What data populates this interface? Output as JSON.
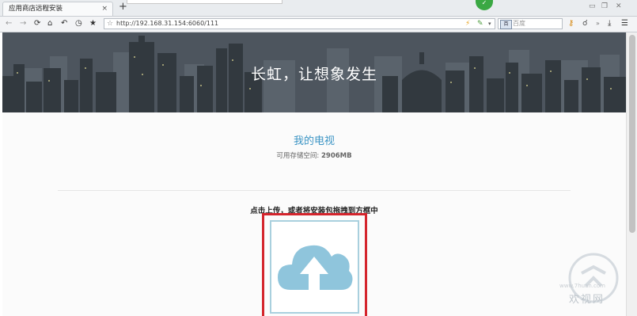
{
  "browser": {
    "tab_title": "应用商店远程安装",
    "tab_close": "×",
    "new_tab": "+",
    "url": "http://192.168.31.154:6060/111",
    "search_placeholder": "百度",
    "search_engine_label": "百"
  },
  "banner": {
    "title": "长虹，让想象发生"
  },
  "main": {
    "section_title": "我的电视",
    "storage_label": "可用存储空间:",
    "storage_value": "2906MB",
    "upload_instruction": "点击上传，或者将安装包拖拽到方框中"
  },
  "watermark": {
    "text": "欢视网",
    "url": "www.7huan.com"
  },
  "colors": {
    "banner_bg": "#4b535c",
    "accent_title": "#3b94c4",
    "drop_border": "#d4242c",
    "cloud": "#8fc5dc"
  }
}
